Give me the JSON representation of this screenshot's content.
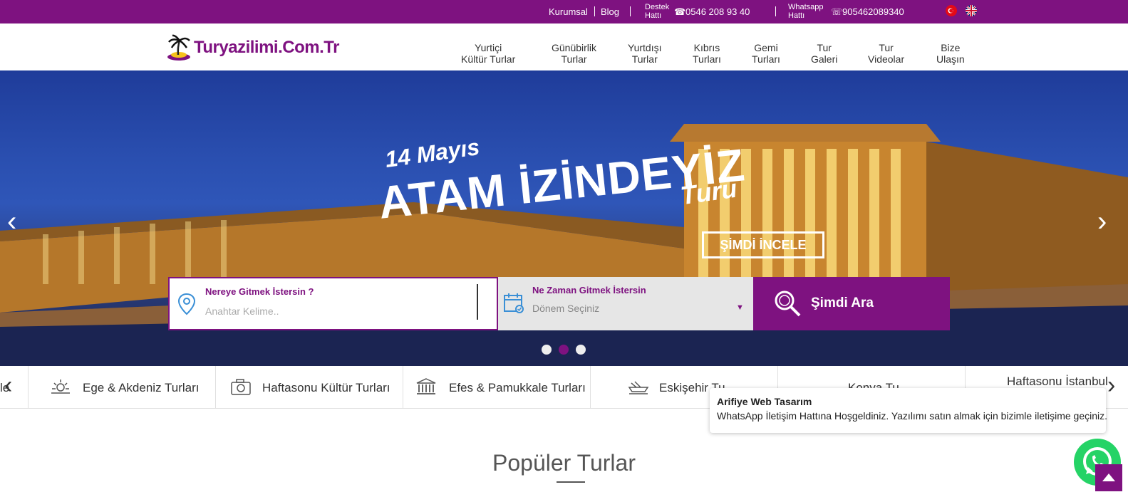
{
  "topbar": {
    "kurumsal": "Kurumsal",
    "blog": "Blog",
    "destek_label_1": "Destek",
    "destek_label_2": "Hattı",
    "destek_phone": "0546 208 93 40",
    "whatsapp_label_1": "Whatsapp",
    "whatsapp_label_2": "Hattı",
    "whatsapp_phone": "905462089340"
  },
  "logo": {
    "text": "Turyazilimi.Com.Tr"
  },
  "nav": [
    {
      "l1": "Yurtiçi",
      "l2": "Kültür Turlar"
    },
    {
      "l1": "Günübirlik",
      "l2": "Turlar"
    },
    {
      "l1": "Yurtdışı",
      "l2": "Turlar"
    },
    {
      "l1": "Kıbrıs",
      "l2": "Turları"
    },
    {
      "l1": "Gemi",
      "l2": "Turları"
    },
    {
      "l1": "Tur",
      "l2": "Galeri"
    },
    {
      "l1": "Tur",
      "l2": "Videolar"
    },
    {
      "l1": "Bize",
      "l2": "Ulaşın"
    }
  ],
  "slide": {
    "small": "14 Mayıs",
    "title": "ATAM İZİNDEYİZ",
    "script": "Turu",
    "button": "ŞİMDİ İNCELE"
  },
  "search": {
    "where_label": "Nereye Gitmek İstersin ?",
    "where_placeholder": "Anahtar Kelime..",
    "when_label": "Ne Zaman Gitmek İstersin",
    "when_value": "Dönem Seçiniz",
    "button": "Şimdi Ara"
  },
  "categories": [
    {
      "label": "le",
      "icon": ""
    },
    {
      "label": "Ege & Akdeniz Turları",
      "icon": "sun-icon"
    },
    {
      "label": "Haftasonu Kültür Turları",
      "icon": "camera-icon"
    },
    {
      "label": "Efes & Pamukkale Turları",
      "icon": "temple-icon"
    },
    {
      "label": "Eskişehir Tu",
      "icon": "boat-icon"
    },
    {
      "label": "Konya Tu",
      "icon": "dervish-icon"
    },
    {
      "label": "Haftasonu İstanbul",
      "icon": "tower-icon"
    }
  ],
  "popup": {
    "title": "Arifiye Web Tasarım",
    "message": "WhatsApp İletişim Hattına Hoşgeldiniz. Yazılımı satın almak için bizimle iletişime geçiniz."
  },
  "section": {
    "title": "Popüler Turlar"
  },
  "colors": {
    "brand": "#7e1280",
    "whatsapp": "#25d366"
  }
}
